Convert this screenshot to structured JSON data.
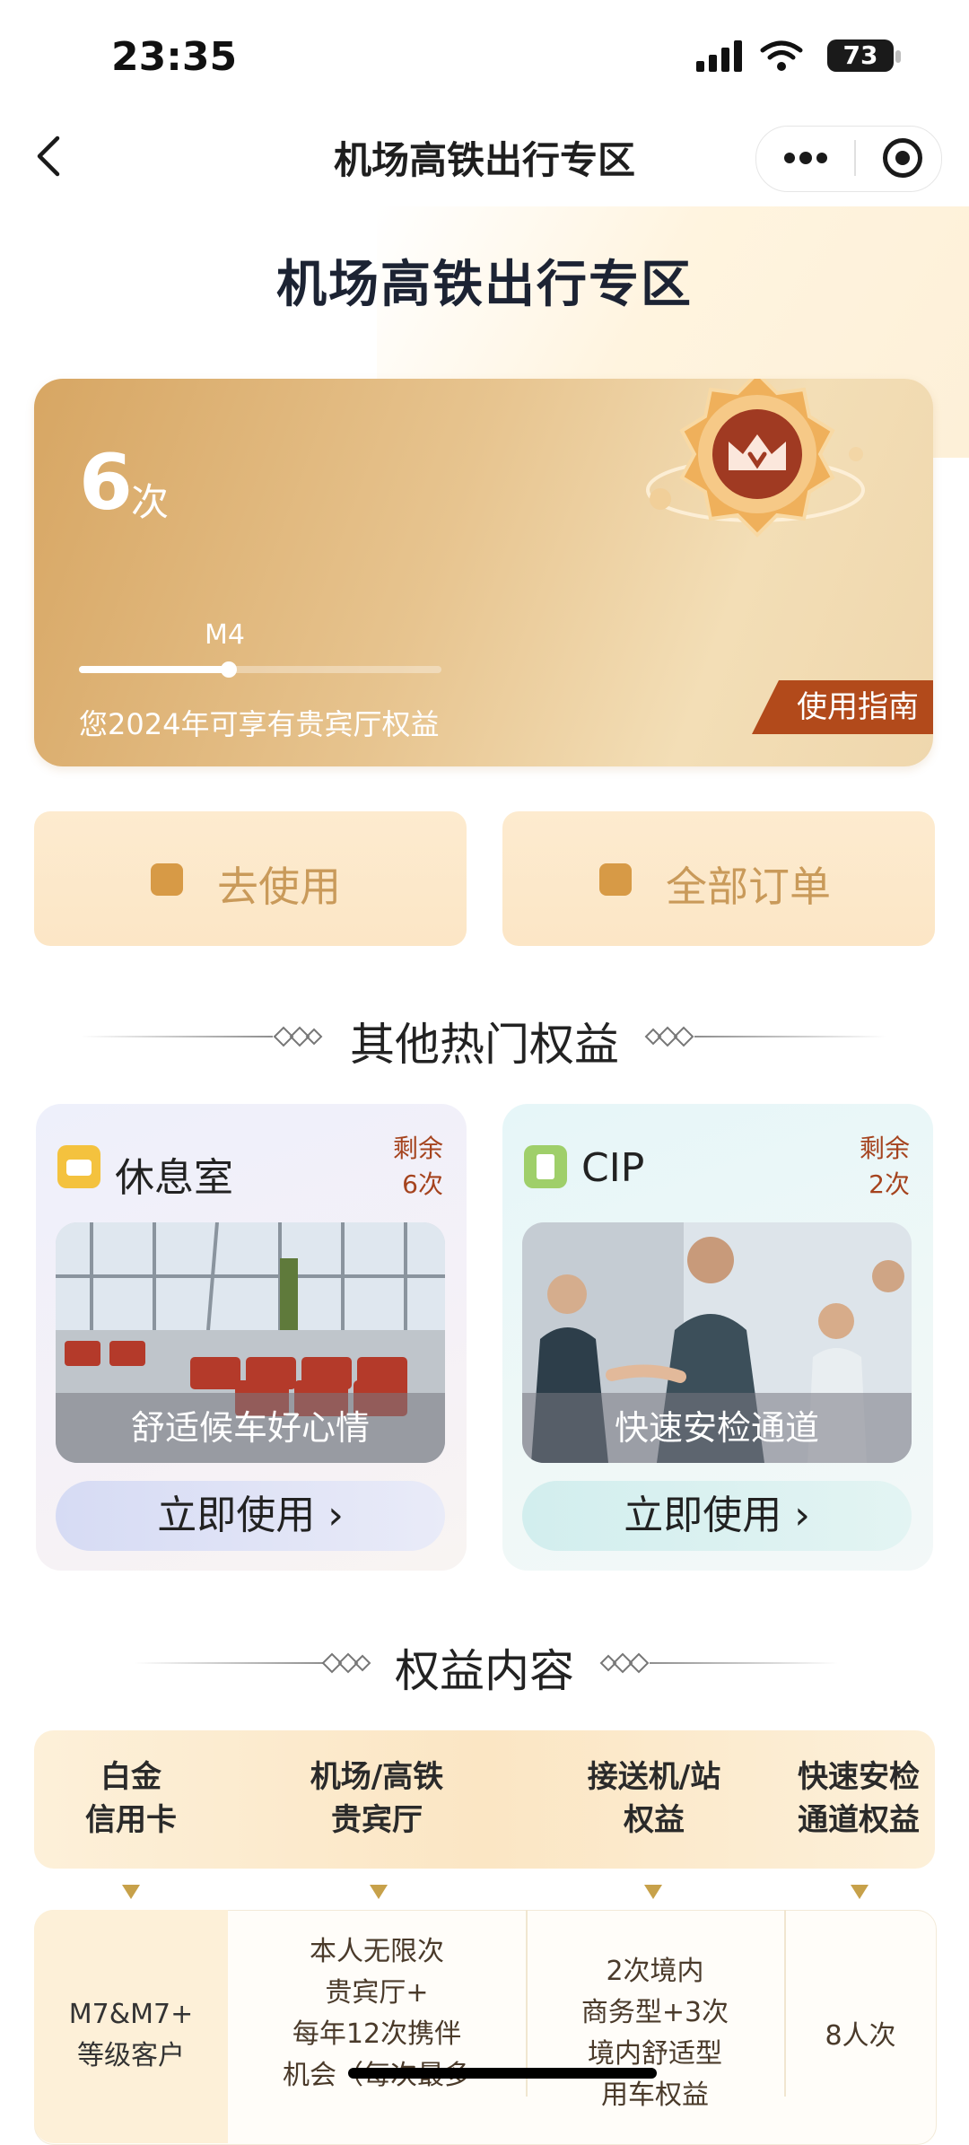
{
  "status_bar": {
    "time": "23:35",
    "battery": "73"
  },
  "nav": {
    "title": "机场高铁出行专区"
  },
  "hero": {
    "heading": "机场高铁出行专区",
    "count_value": "6",
    "count_unit": "次",
    "level": "M4",
    "level_progress": 0.42,
    "description": "您2024年可享有贵宾厅权益",
    "guide_label": "使用指南"
  },
  "actions": {
    "use_label": "去使用",
    "orders_label": "全部订单"
  },
  "section_hot": {
    "title": "其他热门权益"
  },
  "benefits": [
    {
      "title": "休息室",
      "remain_label": "剩余",
      "remain_value": "6次",
      "caption": "舒适候车好心情",
      "button": "立即使用 ›",
      "icon": "sofa-icon"
    },
    {
      "title": "CIP",
      "remain_label": "剩余",
      "remain_value": "2次",
      "caption": "快速安检通道",
      "button": "立即使用 ›",
      "icon": "document-icon"
    }
  ],
  "section_content": {
    "title": "权益内容"
  },
  "table": {
    "headers": [
      "白金\n信用卡",
      "机场/高铁\n贵宾厅",
      "接送机/站\n权益",
      "快速安检\n通道权益"
    ],
    "row": [
      "M7&M7+\n等级客户",
      "本人无限次\n贵宾厅+\n每年12次携伴\n机会（每次最多",
      "2次境内\n商务型+3次\n境内舒适型\n用车权益",
      "8人次"
    ]
  },
  "colors": {
    "accent_gold": "#d7a663",
    "guide_red": "#b24a1b",
    "remain_red": "#a5431e"
  }
}
